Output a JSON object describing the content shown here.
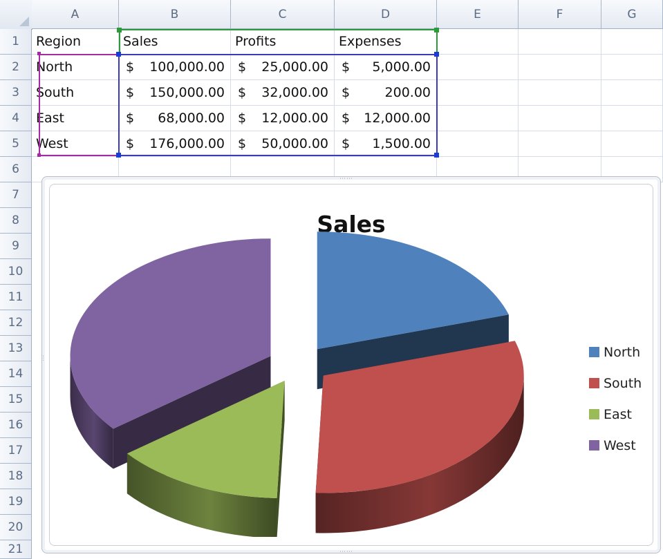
{
  "sheet": {
    "columns": [
      "A",
      "B",
      "C",
      "D",
      "E",
      "F",
      "G"
    ],
    "rows": [
      "1",
      "2",
      "3",
      "4",
      "5",
      "6",
      "7",
      "8",
      "9",
      "10",
      "11",
      "12",
      "13",
      "14",
      "15",
      "16",
      "17",
      "18",
      "19",
      "20",
      "21"
    ],
    "headers": {
      "region": "Region",
      "sales": "Sales",
      "profits": "Profits",
      "expenses": "Expenses"
    },
    "data": [
      {
        "region": "North",
        "sales": "100,000.00",
        "profits": "25,000.00",
        "expenses": "5,000.00"
      },
      {
        "region": "South",
        "sales": "150,000.00",
        "profits": "32,000.00",
        "expenses": "200.00"
      },
      {
        "region": "East",
        "sales": "68,000.00",
        "profits": "12,000.00",
        "expenses": "12,000.00"
      },
      {
        "region": "West",
        "sales": "176,000.00",
        "profits": "50,000.00",
        "expenses": "1,500.00"
      }
    ],
    "currency_symbol": "$",
    "colors": {
      "selection_range": "#3b3bb8",
      "label_range": "#a52ba5",
      "header_handle": "#1f8a2e",
      "data_handle": "#1a3cd6"
    }
  },
  "chart_data": {
    "type": "pie",
    "title": "Sales",
    "categories": [
      "North",
      "South",
      "East",
      "West"
    ],
    "values": [
      100000,
      150000,
      68000,
      176000
    ],
    "colors": [
      "#4f81bd",
      "#c0504d",
      "#9bbb59",
      "#8064a2"
    ],
    "exploded": true,
    "three_d": true,
    "legend_position": "right"
  }
}
